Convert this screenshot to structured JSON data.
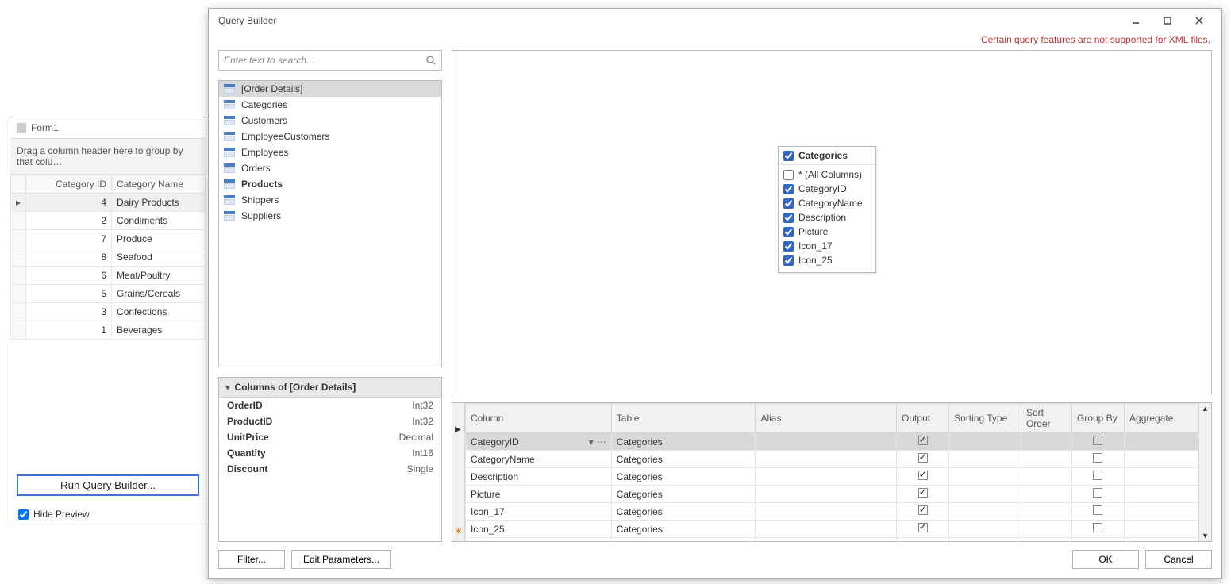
{
  "form1": {
    "title": "Form1",
    "group_hint": "Drag a column header here to group by that colu…",
    "headers": {
      "id": "Category ID",
      "name": "Category Name"
    },
    "rows": [
      {
        "id": 4,
        "name": "Dairy Products",
        "selected": true
      },
      {
        "id": 2,
        "name": "Condiments"
      },
      {
        "id": 7,
        "name": "Produce"
      },
      {
        "id": 8,
        "name": "Seafood"
      },
      {
        "id": 6,
        "name": "Meat/Poultry"
      },
      {
        "id": 5,
        "name": "Grains/Cereals"
      },
      {
        "id": 3,
        "name": "Confections"
      },
      {
        "id": 1,
        "name": "Beverages"
      }
    ],
    "run_button": "Run Query Builder...",
    "hide_preview": "Hide Preview",
    "hide_preview_checked": true
  },
  "qb": {
    "title": "Query Builder",
    "warning": "Certain query features are not supported for XML files.",
    "search_placeholder": "Enter text to search...",
    "tables": [
      {
        "name": "[Order Details]",
        "selected": true
      },
      {
        "name": "Categories"
      },
      {
        "name": "Customers"
      },
      {
        "name": "EmployeeCustomers"
      },
      {
        "name": "Employees"
      },
      {
        "name": "Orders"
      },
      {
        "name": "Products",
        "bold": true
      },
      {
        "name": "Shippers"
      },
      {
        "name": "Suppliers"
      }
    ],
    "columns_panel": {
      "header": "Columns of [Order Details]",
      "cols": [
        {
          "name": "OrderID",
          "type": "Int32"
        },
        {
          "name": "ProductID",
          "type": "Int32"
        },
        {
          "name": "UnitPrice",
          "type": "Decimal"
        },
        {
          "name": "Quantity",
          "type": "Int16"
        },
        {
          "name": "Discount",
          "type": "Single"
        }
      ]
    },
    "entity": {
      "title": "Categories",
      "header_checked": true,
      "fields": [
        {
          "label": "* (All Columns)",
          "checked": false
        },
        {
          "label": "CategoryID",
          "checked": true
        },
        {
          "label": "CategoryName",
          "checked": true
        },
        {
          "label": "Description",
          "checked": true
        },
        {
          "label": "Picture",
          "checked": true
        },
        {
          "label": "Icon_17",
          "checked": true
        },
        {
          "label": "Icon_25",
          "checked": true
        }
      ]
    },
    "grid": {
      "headers": {
        "column": "Column",
        "table": "Table",
        "alias": "Alias",
        "output": "Output",
        "sort_type": "Sorting Type",
        "sort_order": "Sort Order",
        "group_by": "Group By",
        "aggregate": "Aggregate"
      },
      "rows": [
        {
          "column": "CategoryID",
          "table": "Categories",
          "output": true,
          "group": false,
          "selected": true,
          "editing": true
        },
        {
          "column": "CategoryName",
          "table": "Categories",
          "output": true,
          "group": false
        },
        {
          "column": "Description",
          "table": "Categories",
          "output": true,
          "group": false
        },
        {
          "column": "Picture",
          "table": "Categories",
          "output": true,
          "group": false
        },
        {
          "column": "Icon_17",
          "table": "Categories",
          "output": true,
          "group": false
        },
        {
          "column": "Icon_25",
          "table": "Categories",
          "output": true,
          "group": false
        }
      ]
    },
    "buttons": {
      "filter": "Filter...",
      "edit_params": "Edit Parameters...",
      "ok": "OK",
      "cancel": "Cancel"
    }
  }
}
